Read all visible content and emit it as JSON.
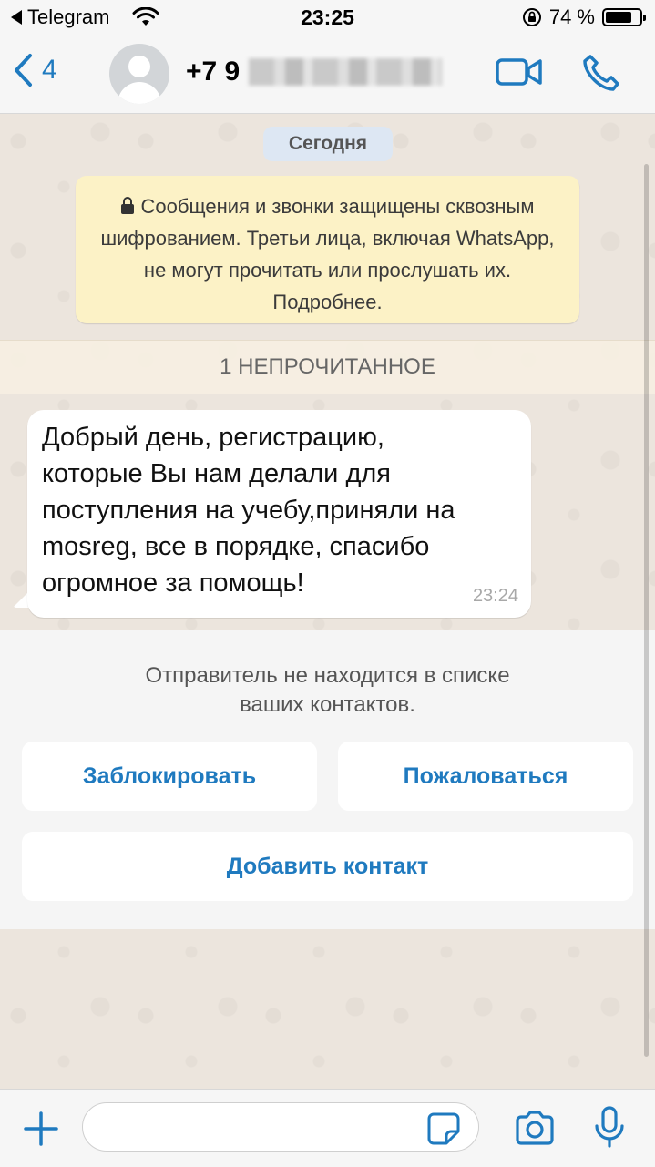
{
  "status_bar": {
    "back_app": "Telegram",
    "time": "23:25",
    "battery": "74 %"
  },
  "header": {
    "back_count": "4",
    "contact_name_visible": "+7 9",
    "icons": [
      "chevron-left-icon",
      "avatar-icon",
      "video-call-icon",
      "phone-call-icon"
    ]
  },
  "chat": {
    "date_label": "Сегодня",
    "encryption_notice": "Сообщения и звонки защищены сквозным шифрованием. Третьи лица, включая WhatsApp, не могут прочитать или прослушать их. Подробнее.",
    "unread_label": "1 НЕПРОЧИТАННОЕ",
    "messages": [
      {
        "text": "Добрый день, регистрацию,\nкоторые Вы нам делали для\nпоступления на учебу,приняли на\nmosreg, все в порядке, спасибо\nогромное за помощь!",
        "time": "23:24"
      }
    ]
  },
  "unknown_sender": {
    "note": "Отправитель не находится в списке\nваших контактов.",
    "block_label": "Заблокировать",
    "report_label": "Пожаловаться",
    "add_contact_label": "Добавить контакт"
  },
  "input_bar": {
    "value": "",
    "icons": [
      "plus-icon",
      "sticker-icon",
      "camera-icon",
      "microphone-icon"
    ]
  },
  "colors": {
    "accent": "#1f7abf",
    "encryption_bg": "#fcf2c6",
    "date_pill_bg": "#dde7f3",
    "chat_bg": "#ece5dd"
  }
}
